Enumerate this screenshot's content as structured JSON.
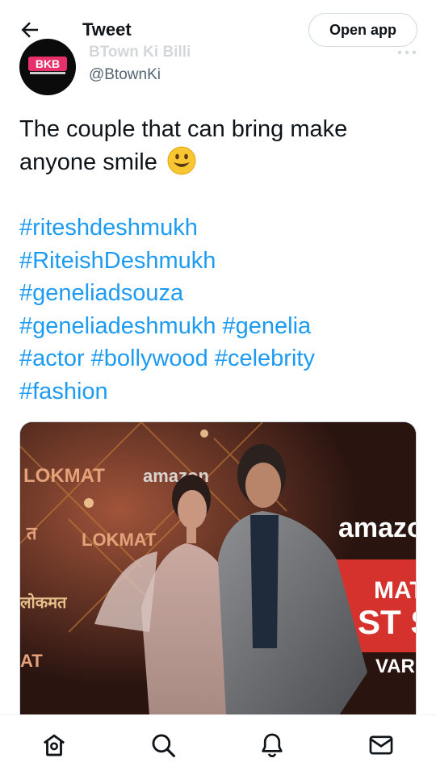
{
  "header": {
    "title": "Tweet",
    "open_app_label": "Open app"
  },
  "author": {
    "display_name": "BTown Ki Billi",
    "handle": "@BtownKi",
    "avatar_logo_text": "BKB"
  },
  "tweet": {
    "text": "The couple that can bring make anyone smile",
    "emoji": "smiling-face-emoji",
    "hashtag_lines": [
      [
        "#riteshdeshmukh"
      ],
      [
        "#RiteishDeshmukh"
      ],
      [
        "#geneliadsouza"
      ],
      [
        "#geneliadeshmukh",
        "#genelia"
      ],
      [
        "#actor",
        "#bollywood",
        "#celebrity"
      ],
      [
        "#fashion"
      ]
    ]
  },
  "media": {
    "backdrop_texts": [
      "LOKMAT",
      "amazon",
      "LOKMAT",
      "amazon",
      "MAT",
      "ST S",
      "VARD",
      "AT",
      "लोकमत",
      "त"
    ]
  },
  "nav": {
    "items": [
      "home-icon",
      "search-icon",
      "notifications-icon",
      "messages-icon"
    ]
  },
  "colors": {
    "accent": "#1d9bf0",
    "text": "#0f1419",
    "muted": "#536471",
    "border": "#cfd9de"
  }
}
